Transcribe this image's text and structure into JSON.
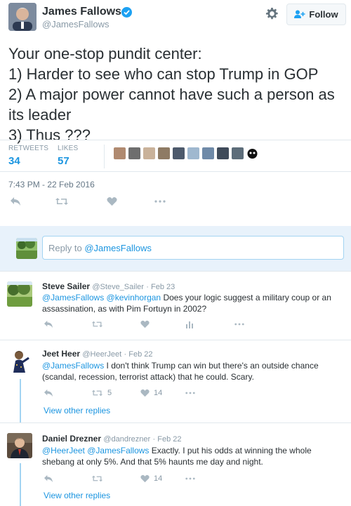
{
  "author": {
    "name": "James Fallows",
    "handle": "@JamesFallows"
  },
  "follow_label": "Follow",
  "tweet": {
    "lines": [
      "Your one-stop pundit center:",
      "1) Harder to see who can stop Trump in GOP",
      "2) A major power cannot have such a person as",
      "its leader",
      "3) Thus ???"
    ],
    "retweets_label": "RETWEETS",
    "retweets": "34",
    "likes_label": "LIKES",
    "likes": "57",
    "timestamp": "7:43 PM - 22 Feb 2016"
  },
  "reply_box": {
    "prefix": "Reply to ",
    "mention": "@JamesFallows"
  },
  "replies": [
    {
      "name": "Steve Sailer",
      "handle": "@Steve_Sailer",
      "date": "· Feb 23",
      "mention1": "@JamesFallows",
      "mention2": "@kevinhorgan",
      "text": " Does your logic suggest a military coup or an assassination, as with Pim Fortuyn in 2002?"
    },
    {
      "name": "Jeet Heer",
      "handle": "@HeerJeet",
      "date": "· Feb 22",
      "mention1": "@JamesFallows",
      "text": " I don't think Trump can win but there's an outside chance (scandal, recession, terrorist attack) that he could. Scary.",
      "retweets": "5",
      "likes": "14",
      "view_replies": "View other replies"
    },
    {
      "name": "Daniel Drezner",
      "handle": "@dandrezner",
      "date": "· Feb 22",
      "mention1": "@HeerJeet",
      "mention2": "@JamesFallows",
      "text": " Exactly. I put his odds at winning the whole shebang at only 5%. And that 5% haunts me day and night.",
      "likes": "14",
      "view_replies": "View other replies"
    }
  ],
  "icons": {
    "reply": "reply-icon",
    "retweet": "retweet-icon",
    "like": "heart-icon",
    "more": "more-icon",
    "analytics": "analytics-icon",
    "settings": "gear-icon",
    "verified": "verified-badge-icon"
  },
  "colors": {
    "link": "#1b95e0",
    "muted": "#8899a6",
    "text": "#292f33",
    "reply_area": "#e8f2fb",
    "thread_line": "#a3d4f2"
  }
}
